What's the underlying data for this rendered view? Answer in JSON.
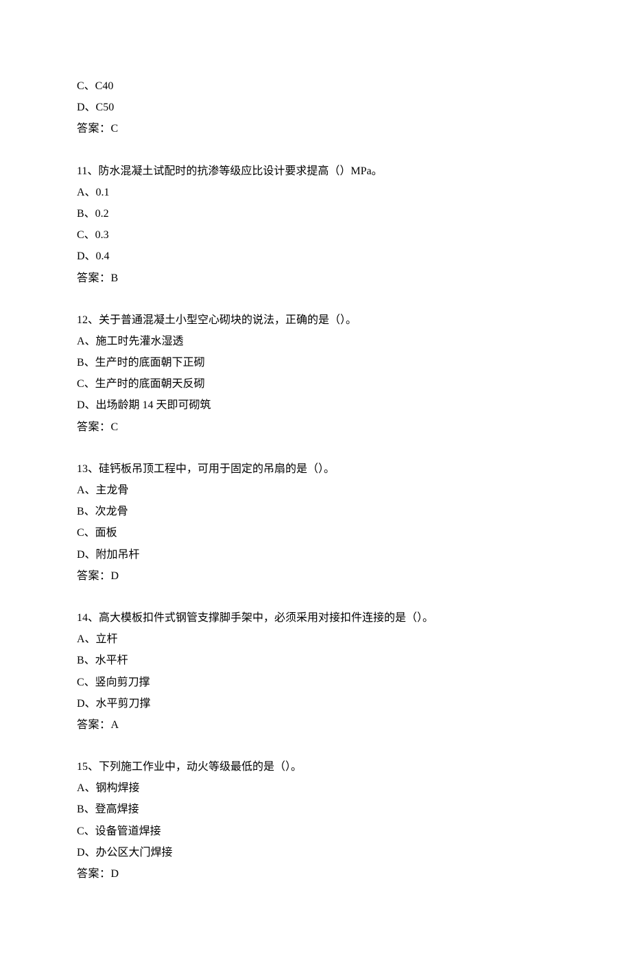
{
  "questions": [
    {
      "id": "q10",
      "extra_options": [
        {
          "label": "C、C40"
        },
        {
          "label": "D、C50"
        }
      ],
      "answer_label": "答案：C"
    },
    {
      "id": "q11",
      "stem": "11、防水混凝土试配时的抗渗等级应比设计要求提高（）MPa。",
      "options": [
        {
          "label": "A、0.1"
        },
        {
          "label": "B、0.2"
        },
        {
          "label": "C、0.3"
        },
        {
          "label": "D、0.4"
        }
      ],
      "answer_label": "答案：B"
    },
    {
      "id": "q12",
      "stem": "12、关于普通混凝土小型空心砌块的说法，正确的是（）。",
      "options": [
        {
          "label": "A、施工时先灌水湿透"
        },
        {
          "label": "B、生产时的底面朝下正砌"
        },
        {
          "label": "C、生产时的底面朝天反砌"
        },
        {
          "label": "D、出场龄期 14 天即可砌筑"
        }
      ],
      "answer_label": "答案：C"
    },
    {
      "id": "q13",
      "stem": "13、硅钙板吊顶工程中，可用于固定的吊扇的是（）。",
      "options": [
        {
          "label": "A、主龙骨"
        },
        {
          "label": "B、次龙骨"
        },
        {
          "label": "C、面板"
        },
        {
          "label": "D、附加吊杆"
        }
      ],
      "answer_label": "答案：D"
    },
    {
      "id": "q14",
      "stem": "14、高大模板扣件式钢管支撑脚手架中，必须采用对接扣件连接的是（）。",
      "options": [
        {
          "label": "A、立杆"
        },
        {
          "label": "B、水平杆"
        },
        {
          "label": "C、竖向剪刀撑"
        },
        {
          "label": "D、水平剪刀撑"
        }
      ],
      "answer_label": "答案：A"
    },
    {
      "id": "q15",
      "stem": "15、下列施工作业中，动火等级最低的是（）。",
      "options": [
        {
          "label": "A、钢构焊接"
        },
        {
          "label": "B、登高焊接"
        },
        {
          "label": "C、设备管道焊接"
        },
        {
          "label": "D、办公区大门焊接"
        }
      ],
      "answer_label": "答案：D"
    }
  ]
}
